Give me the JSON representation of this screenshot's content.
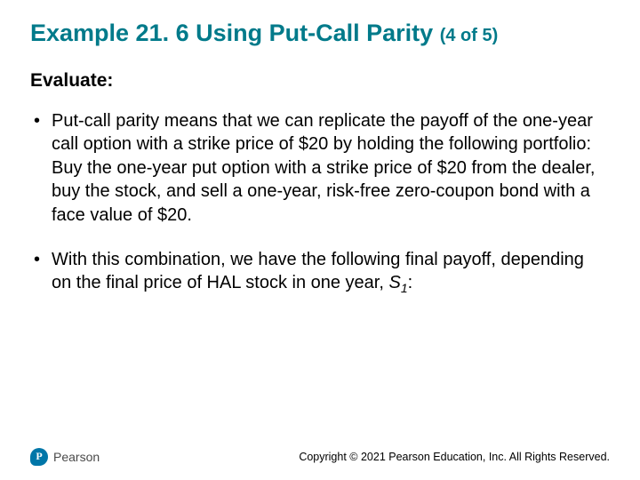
{
  "title": {
    "main": "Example 21. 6 Using Put-Call Parity",
    "suffix": "(4 of 5)"
  },
  "evaluate_label": "Evaluate:",
  "bullets": [
    "Put-call parity means that we can replicate the payoff of the one-year call option with a strike price of $20 by holding the following portfolio: Buy the one-year put option with a strike price of $20 from the dealer, buy the stock, and sell a one-year, risk-free zero-coupon bond with a face value of $20.",
    "With this combination, we have the following final payoff, depending on the final price of HAL stock in one year, "
  ],
  "bullet2_symbol": "S",
  "bullet2_sub": "1",
  "bullet2_tail": ":",
  "footer": {
    "brand": "Pearson",
    "copyright": "Copyright © 2021 Pearson Education, Inc. All Rights Reserved."
  }
}
